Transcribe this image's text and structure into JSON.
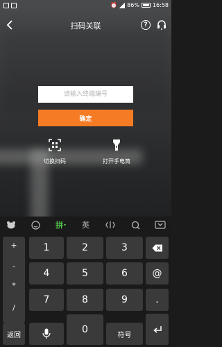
{
  "status_bar": {
    "battery": "86%",
    "time": "16:58"
  },
  "header": {
    "title": "扫码关联"
  },
  "form": {
    "placeholder": "请输入终端编号",
    "confirm_label": "确定"
  },
  "actions": {
    "scan_label": "切换扫码",
    "flashlight_label": "打开手电筒"
  },
  "keyboard": {
    "toolbar": {
      "pinyin": "拼",
      "english": "英"
    },
    "symbols": [
      "+",
      "-",
      "*",
      "/"
    ],
    "digits": [
      "1",
      "2",
      "3",
      "4",
      "5",
      "6",
      "7",
      "8",
      "9",
      "0"
    ],
    "right_keys": {
      "at": "@",
      "dot": "."
    },
    "bottom": {
      "back": "返回",
      "symbols": "符号"
    }
  }
}
